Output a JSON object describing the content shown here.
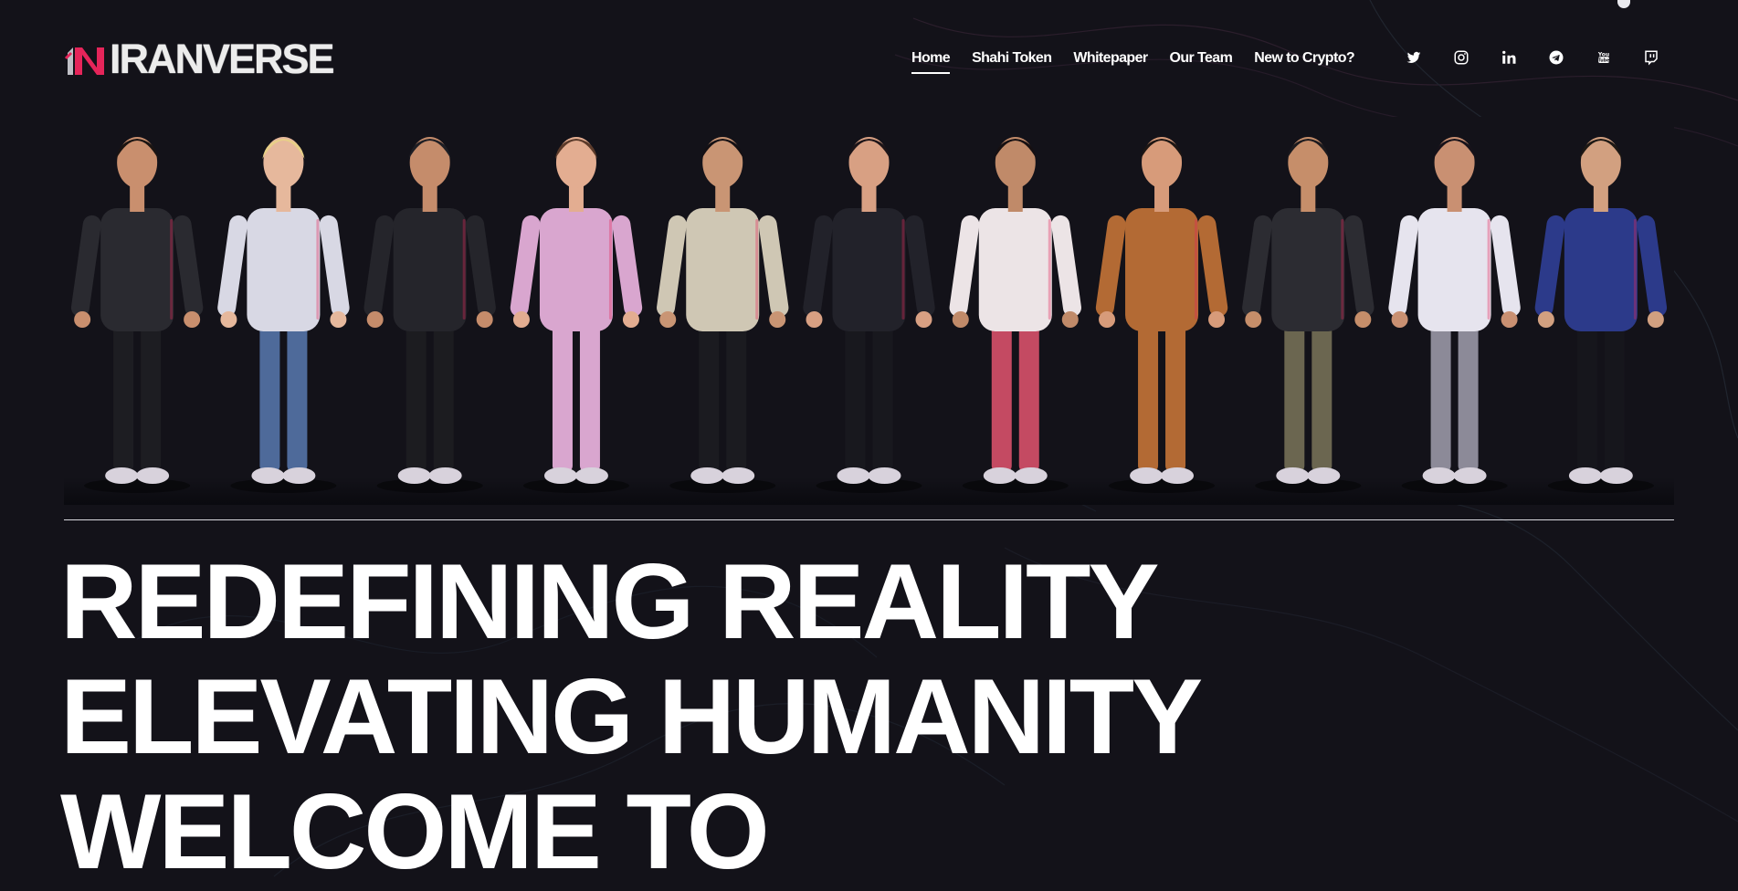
{
  "brand": {
    "logo_text": "IRANVERSE",
    "accent": "#e5255a"
  },
  "nav": {
    "items": [
      {
        "label": "Home",
        "active": true
      },
      {
        "label": "Shahi Token",
        "active": false
      },
      {
        "label": "Whitepaper",
        "active": false
      },
      {
        "label": "Our Team",
        "active": false
      },
      {
        "label": "New to Crypto?",
        "active": false
      }
    ]
  },
  "socials": [
    "twitter-icon",
    "instagram-icon",
    "linkedin-icon",
    "telegram-icon",
    "youtube-icon",
    "twitch-icon"
  ],
  "hero": {
    "avatars": [
      {
        "name": "avatar-man-black-coat",
        "top": "#2a2a30",
        "bottom": "#1d1d22",
        "skin": "#c98f6e",
        "hair": "#1a1412"
      },
      {
        "name": "avatar-woman-blonde-jeans",
        "top": "#d8d8e4",
        "bottom": "#4e6a9a",
        "skin": "#e6b89c",
        "hair": "#e8cf88"
      },
      {
        "name": "avatar-man-black-hoodie",
        "top": "#25252b",
        "bottom": "#1c1c20",
        "skin": "#c58c6b",
        "hair": "#1e1e24"
      },
      {
        "name": "avatar-woman-pink-dress",
        "top": "#d9a6cf",
        "bottom": "#d9a6cf",
        "skin": "#e3ad91",
        "hair": "#5a3a2a"
      },
      {
        "name": "avatar-man-beige-jacket",
        "top": "#cfc7b4",
        "bottom": "#1b1b20",
        "skin": "#c99574",
        "hair": "#141014"
      },
      {
        "name": "avatar-woman-black-jacket",
        "top": "#22222a",
        "bottom": "#18181e",
        "skin": "#d8a083",
        "hair": "#1c1418"
      },
      {
        "name": "avatar-man-white-sherwani",
        "top": "#ece4e6",
        "bottom": "#c44a62",
        "skin": "#c08a69",
        "hair": "#161012"
      },
      {
        "name": "avatar-woman-tiger-dress",
        "top": "#b36a34",
        "bottom": "#b36a34",
        "skin": "#d79b7a",
        "hair": "#1d1614"
      },
      {
        "name": "avatar-man-camo-pants",
        "top": "#2c2c32",
        "bottom": "#6b6650",
        "skin": "#c68e6a",
        "hair": "#1c1a1e"
      },
      {
        "name": "avatar-woman-white-coat",
        "top": "#e6e4ee",
        "bottom": "#8c8a98",
        "skin": "#c99072",
        "hair": "#17121a"
      },
      {
        "name": "avatar-man-blue-sweater",
        "top": "#2c3a8a",
        "bottom": "#16161c",
        "skin": "#d2a080",
        "hair": "#1d1814"
      }
    ]
  },
  "headline": {
    "line1": "REDEFINING REALITY",
    "line2": "ELEVATING HUMANITY",
    "line3": "WELCOME TO"
  }
}
